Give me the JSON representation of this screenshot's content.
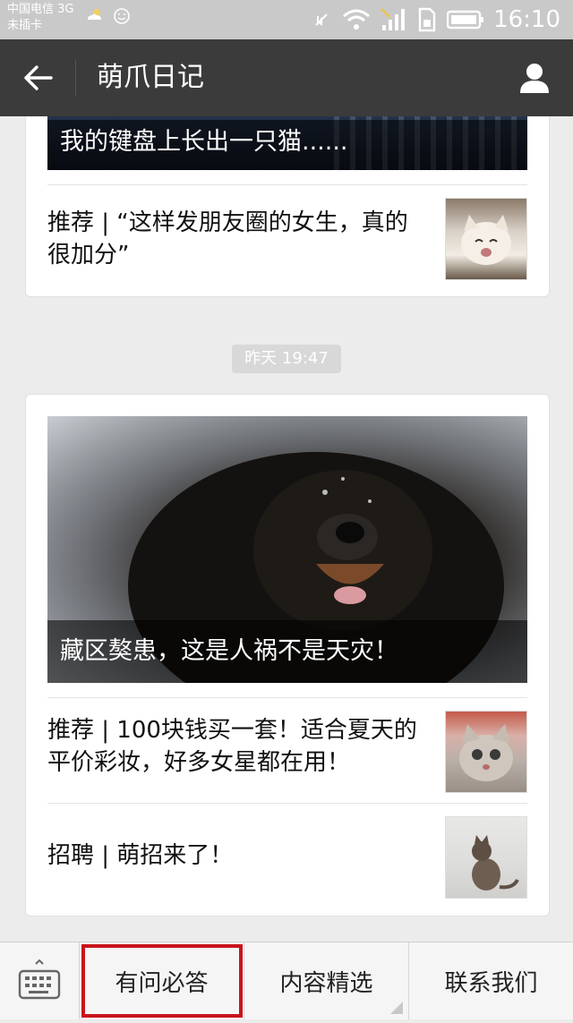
{
  "status_bar": {
    "carrier_line1": "中国电信 3G",
    "carrier_line2": "未插卡",
    "time": "16:10"
  },
  "header": {
    "title": "萌爪日记"
  },
  "feed": {
    "card1": {
      "cover_caption": "我的键盘上长出一只猫......",
      "items": [
        {
          "title": "推荐 | “这样发朋友圈的女生，真的很加分”",
          "thumb_icon": "crying-kitten-photo"
        }
      ]
    },
    "timestamp": "昨天 19:47",
    "card2": {
      "cover_caption": "藏区獒患，这是人祸不是天灾！",
      "cover_icon": "tibetan-mastiff-photo",
      "items": [
        {
          "title": "推荐 | 100块钱买一套！适合夏天的平价彩妆，好多女星都在用！",
          "thumb_icon": "grey-kitten-photo"
        },
        {
          "title": "招聘 | 萌招来了！",
          "thumb_icon": "sitting-cat-photo"
        }
      ]
    }
  },
  "bottom_menu": {
    "keyboard_icon": "keyboard-icon",
    "items": [
      "有问必答",
      "内容精选",
      "联系我们"
    ]
  }
}
